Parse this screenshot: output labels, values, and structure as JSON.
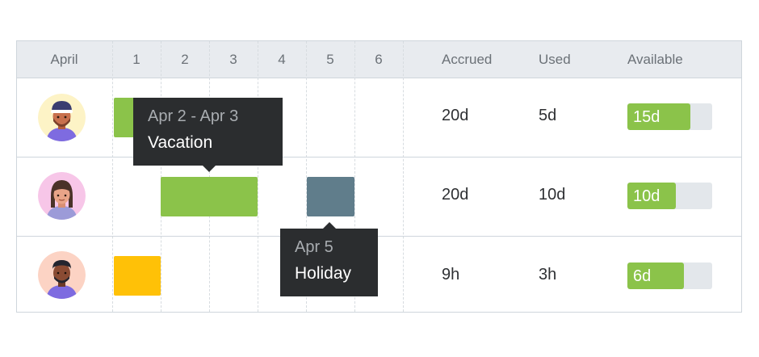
{
  "header": {
    "month": "April",
    "days": [
      "1",
      "2",
      "3",
      "4",
      "5",
      "6"
    ],
    "accrued": "Accrued",
    "used": "Used",
    "available": "Available"
  },
  "rows": [
    {
      "accrued": "20d",
      "used": "5d",
      "available": "15d",
      "available_fraction": 0.74,
      "avatar_bg": "#fdf3c6"
    },
    {
      "accrued": "20d",
      "used": "10d",
      "available": "10d",
      "available_fraction": 0.57,
      "avatar_bg": "#f7c6e8"
    },
    {
      "accrued": "9h",
      "used": "3h",
      "available": "6d",
      "available_fraction": 0.67,
      "avatar_bg": "#fcd3c4"
    }
  ],
  "tooltips": {
    "vacation": {
      "dates": "Apr 2 - Apr 3",
      "type": "Vacation"
    },
    "holiday": {
      "dates": "Apr 5",
      "type": "Holiday"
    }
  },
  "colors": {
    "vacation": "#8bc34a",
    "holiday": "#607d8b",
    "other": "#ffc107",
    "available": "#8bc34a",
    "track": "#e3e7eb"
  },
  "icons": {
    "avatar_1": "man-with-cap-avatar-icon",
    "avatar_2": "woman-avatar-icon",
    "avatar_3": "man-avatar-icon"
  }
}
